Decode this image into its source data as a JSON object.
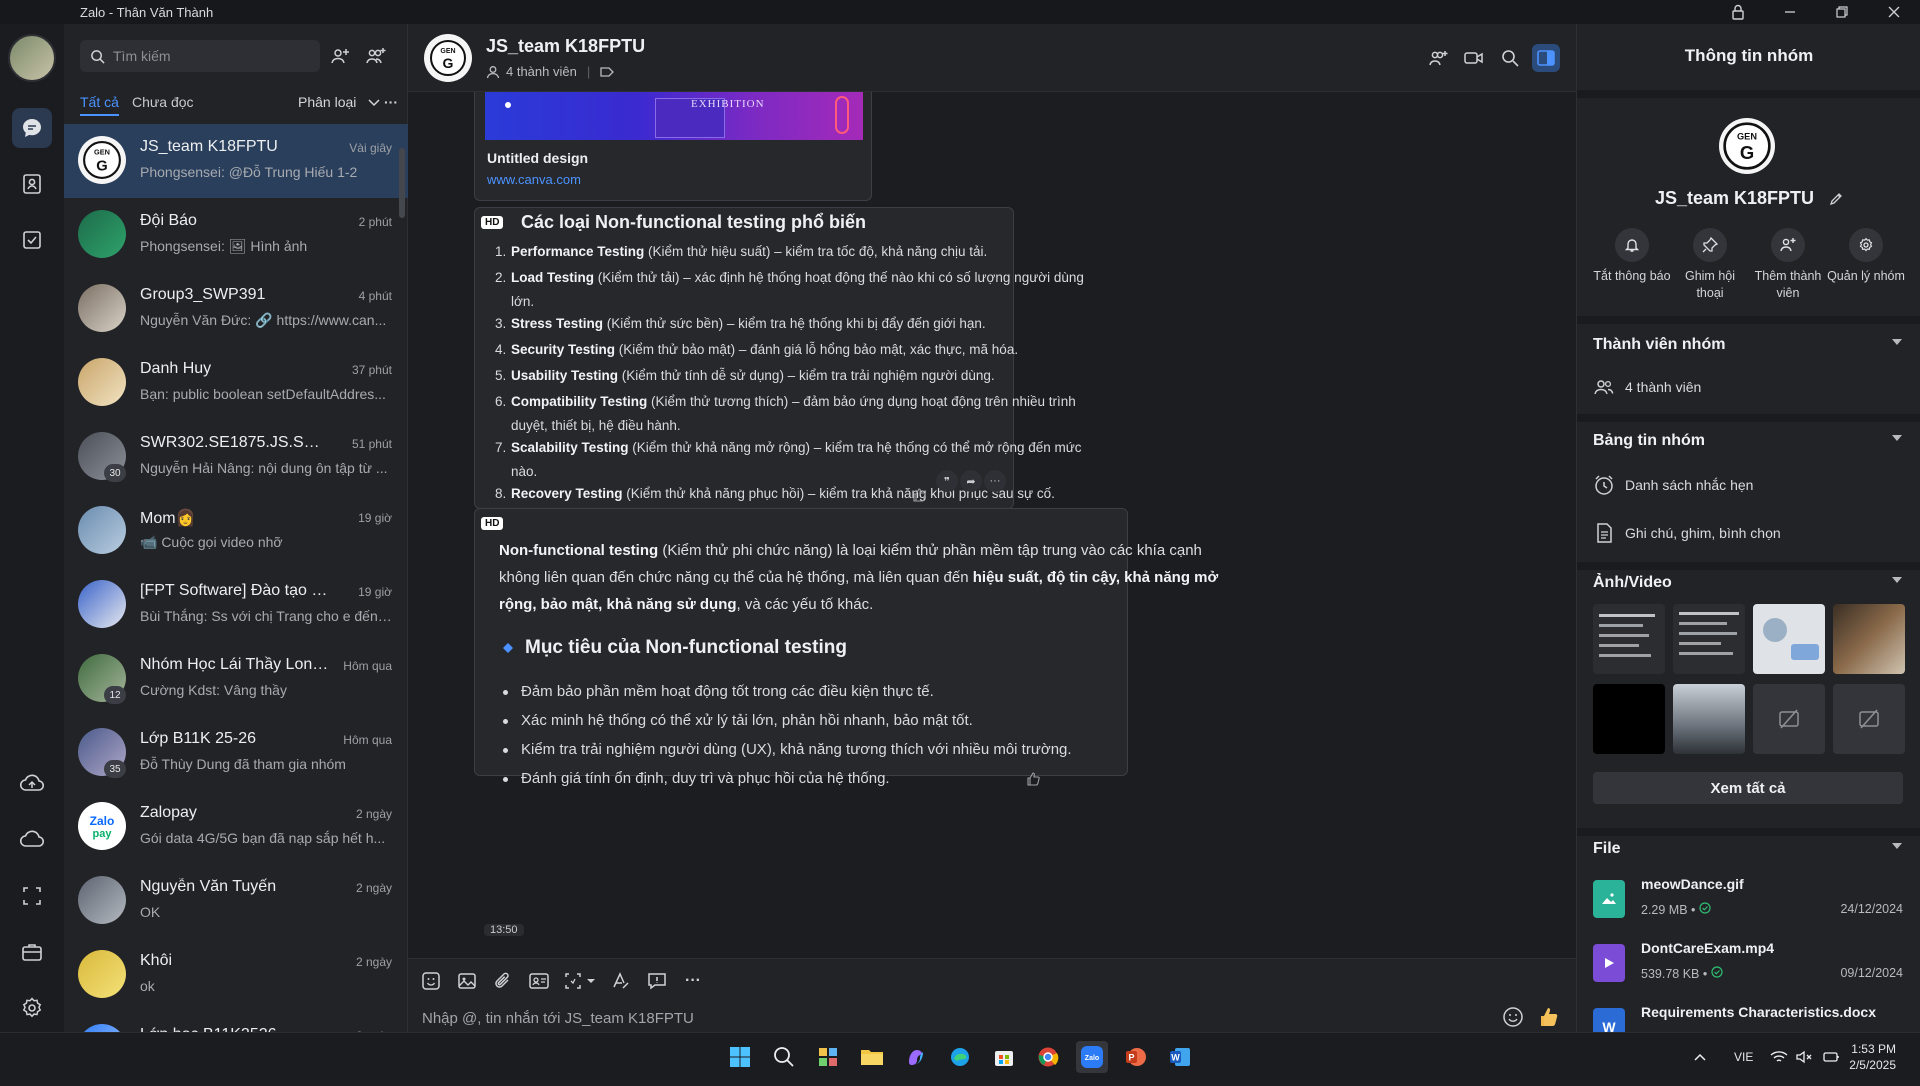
{
  "window": {
    "title": "Zalo - Thân Văn Thành"
  },
  "search": {
    "placeholder": "Tìm kiếm"
  },
  "filters": {
    "all": "Tất cả",
    "unread": "Chưa đọc",
    "classify": "Phân loại"
  },
  "conversations": [
    {
      "name": "JS_team K18FPTU",
      "time": "Vài giây",
      "preview": "Phongsensei: @Đỗ Trung Hiếu 1-2"
    },
    {
      "name": "Đội Báo",
      "time": "2 phút",
      "preview": "Phongsensei: 🖼 Hình ảnh"
    },
    {
      "name": "Group3_SWP391",
      "time": "4 phút",
      "preview": "Nguyễn Văn Đức: 🔗 https://www.can..."
    },
    {
      "name": "Danh Huy",
      "time": "37 phút",
      "preview": "Bạn: public boolean setDefaultAddres..."
    },
    {
      "name": "SWR302.SE1875.JS.SPR25",
      "time": "51 phút",
      "preview": "Nguyễn Hải Nâng: nội dung ôn tập từ ...",
      "badge": "30"
    },
    {
      "name": "Mom👩",
      "time": "19 giờ",
      "preview": "📹 Cuộc gọi video nhỡ"
    },
    {
      "name": "[FPT Software] Đào tạo FU J...",
      "time": "19 giờ",
      "preview": "Bùi Thắng: Ss với chị Trang cho e đến ..."
    },
    {
      "name": "Nhóm Học Lái Thầy Long ...",
      "time": "Hôm qua",
      "preview": "Cường Kdst: Vâng thầy",
      "badge": "12"
    },
    {
      "name": "Lớp B11K 25-26",
      "time": "Hôm qua",
      "preview": "Đỗ Thùy Dung đã tham gia nhóm",
      "badge": "35"
    },
    {
      "name": "Zalopay",
      "time": "2 ngày",
      "preview": "Gói data 4G/5G bạn đã nạp sắp hết h..."
    },
    {
      "name": "Nguyễn Văn Tuyến",
      "time": "2 ngày",
      "preview": "OK"
    },
    {
      "name": "Khôi",
      "time": "2 ngày",
      "preview": "ok"
    },
    {
      "name": "Lớp học B11K2526",
      "time": "2 ngày",
      "preview": ""
    }
  ],
  "chat": {
    "title": "JS_team K18FPTU",
    "members": "4 thành viên",
    "link_card": {
      "title": "Untitled design",
      "url": "www.canva.com",
      "image_text": "EXHIBITION"
    },
    "badge_hd": "HD",
    "msg1": {
      "title": "Các loại Non-functional testing phổ biến",
      "items": [
        {
          "n": "1.",
          "bold": "Performance Testing",
          "rest": " (Kiểm thử hiệu suất) – kiểm tra tốc độ, khả năng chịu tải."
        },
        {
          "n": "2.",
          "bold": "Load Testing",
          "rest": " (Kiểm thử tải) – xác định hệ thống hoạt động thế nào khi có số lượng người dùng lớn."
        },
        {
          "n": "3.",
          "bold": "Stress Testing",
          "rest": " (Kiểm thử sức bền) – kiểm tra hệ thống khi bị đẩy đến giới hạn."
        },
        {
          "n": "4.",
          "bold": "Security Testing",
          "rest": " (Kiểm thử bảo mật) – đánh giá lỗ hổng bảo mật, xác thực, mã hóa."
        },
        {
          "n": "5.",
          "bold": "Usability Testing",
          "rest": " (Kiểm thử tính dễ sử dụng) – kiểm tra trải nghiệm người dùng."
        },
        {
          "n": "6.",
          "bold": "Compatibility Testing",
          "rest": " (Kiểm thử tương thích) – đảm bảo ứng dụng hoạt động trên nhiều trình duyệt, thiết bị, hệ điều hành."
        },
        {
          "n": "7.",
          "bold": "Scalability Testing",
          "rest": " (Kiểm thử khả năng mở rộng) – kiểm tra hệ thống có thể mở rộng đến mức nào."
        },
        {
          "n": "8.",
          "bold": "Recovery Testing",
          "rest": " (Kiểm thử khả năng phục hồi) – kiểm tra khả năng khôi phục sau sự cố."
        }
      ]
    },
    "msg2": {
      "p_bold1": "Non-functional testing",
      "p_text1": " (Kiểm thử phi chức năng) là loại kiểm thử phần mềm tập trung vào các khía cạnh không liên quan đến chức năng cụ thể của hệ thống, mà liên quan đến ",
      "p_bold2": "hiệu suất, độ tin cậy, khả năng mở rộng, bảo mật, khả năng sử dụng",
      "p_text2": ", và các yếu tố khác.",
      "heading": "Mục tiêu của Non-functional testing",
      "bullets": [
        "Đảm bảo phần mềm hoạt động tốt trong các điều kiện thực tế.",
        "Xác minh hệ thống có thể xử lý tải lớn, phản hồi nhanh, bảo mật tốt.",
        "Kiểm tra trải nghiệm người dùng (UX), khả năng tương thích với nhiều môi trường.",
        "Đánh giá tính ổn định, duy trì và phục hồi của hệ thống."
      ]
    },
    "time_stamp": "13:50",
    "composer_placeholder": "Nhập @, tin nhắn tới JS_team K18FPTU"
  },
  "info": {
    "title": "Thông tin nhóm",
    "group_name": "JS_team K18FPTU",
    "actions": [
      {
        "label": "Tắt thông báo"
      },
      {
        "label": "Ghim hội thoại"
      },
      {
        "label": "Thêm thành viên"
      },
      {
        "label": "Quản lý nhóm"
      }
    ],
    "members_section": "Thành viên nhóm",
    "members_count": "4 thành viên",
    "board_section": "Bảng tin nhóm",
    "reminders": "Danh sách nhắc hẹn",
    "notes": "Ghi chú, ghim, bình chọn",
    "media_section": "Ảnh/Video",
    "see_all": "Xem tất cả",
    "files_section": "File",
    "files": [
      {
        "name": "meowDance.gif",
        "size": "2.29 MB",
        "date": "24/12/2024"
      },
      {
        "name": "DontCareExam.mp4",
        "size": "539.78 KB",
        "date": "09/12/2024"
      },
      {
        "name": "Requirements Characteristics.docx",
        "size": "",
        "date": ""
      }
    ]
  },
  "taskbar": {
    "lang": "VIE",
    "time": "1:53 PM",
    "date": "2/5/2025"
  },
  "colors": {
    "accent": "#4c93ff",
    "active_row": "#2a3f5c",
    "background": "#1c1d20"
  }
}
